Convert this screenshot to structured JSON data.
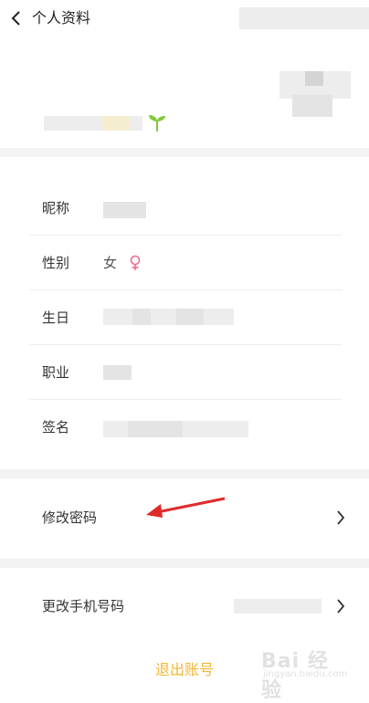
{
  "header": {
    "title": "个人资料",
    "back_icon": "chevron-left-icon"
  },
  "profile": {
    "sprout_icon": "sprout-icon",
    "accent_green": "#7fc93a"
  },
  "info_rows": [
    {
      "label": "昵称"
    },
    {
      "label": "性别",
      "value": "女",
      "icon": "female-icon",
      "icon_color": "#ef6b8a"
    },
    {
      "label": "生日"
    },
    {
      "label": "职业"
    },
    {
      "label": "签名"
    }
  ],
  "security": {
    "change_password": "修改密码",
    "change_phone": "更改手机号码",
    "chevron_icon": "chevron-right-icon"
  },
  "annotation": {
    "arrow_color": "#e02a2a"
  },
  "logout": {
    "label": "退出账号",
    "color": "#f2b632"
  },
  "watermark": {
    "brand": "Bai 经验",
    "url": "jingyan.baidu.com"
  }
}
